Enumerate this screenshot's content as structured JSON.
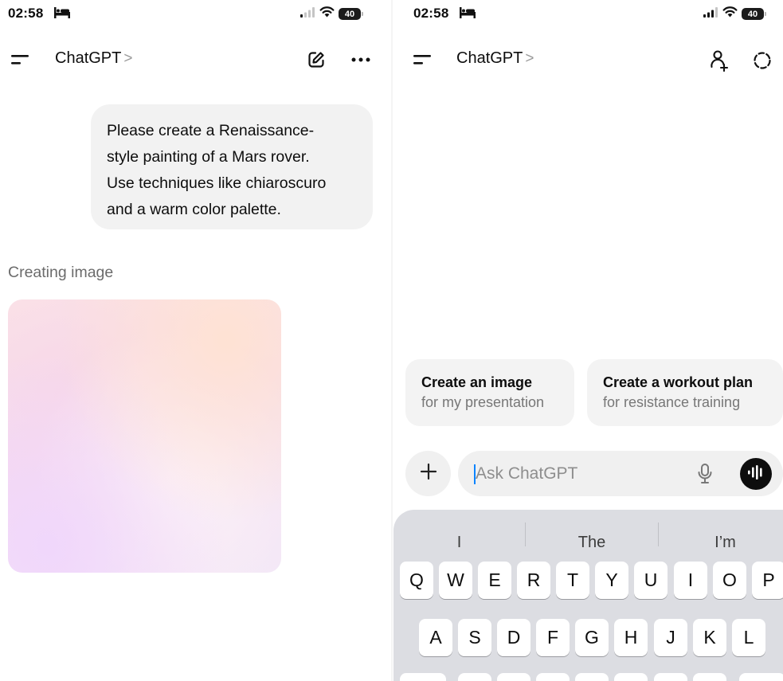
{
  "left": {
    "status": {
      "time": "02:58",
      "battery": "40"
    },
    "nav": {
      "title": "ChatGPT",
      "chevron": ">"
    },
    "user_message": {
      "lines": [
        "Please create a Renaissance-",
        "style painting of a Mars rover.",
        "Use techniques like chiaroscuro",
        "and a warm color palette."
      ]
    },
    "status_text": "Creating image"
  },
  "right": {
    "status": {
      "time": "02:58",
      "battery": "40"
    },
    "nav": {
      "title": "ChatGPT",
      "chevron": ">"
    },
    "suggestions": [
      {
        "title": "Create an image",
        "subtitle": "for my presentation"
      },
      {
        "title": "Create a workout plan",
        "subtitle": "for resistance training"
      }
    ],
    "input": {
      "placeholder": "Ask ChatGPT"
    },
    "keyboard": {
      "predictions": [
        "I",
        "The",
        "I’m"
      ],
      "row1": [
        "Q",
        "W",
        "E",
        "R",
        "T",
        "Y",
        "U",
        "I",
        "O",
        "P"
      ],
      "row2": [
        "A",
        "S",
        "D",
        "F",
        "G",
        "H",
        "J",
        "K",
        "L"
      ]
    }
  },
  "icons": {
    "left_nav": [
      "menu-icon",
      "new-chat-icon",
      "more-icon"
    ],
    "right_nav": [
      "menu-icon",
      "add-person-icon",
      "temporary-chat-icon"
    ],
    "composer": [
      "plus-icon",
      "microphone-icon",
      "voice-mode-icon"
    ]
  },
  "colors": {
    "accent_caret": "#0a84ff",
    "bubble": "#f2f2f2",
    "keyboard": "#dcdde2"
  }
}
